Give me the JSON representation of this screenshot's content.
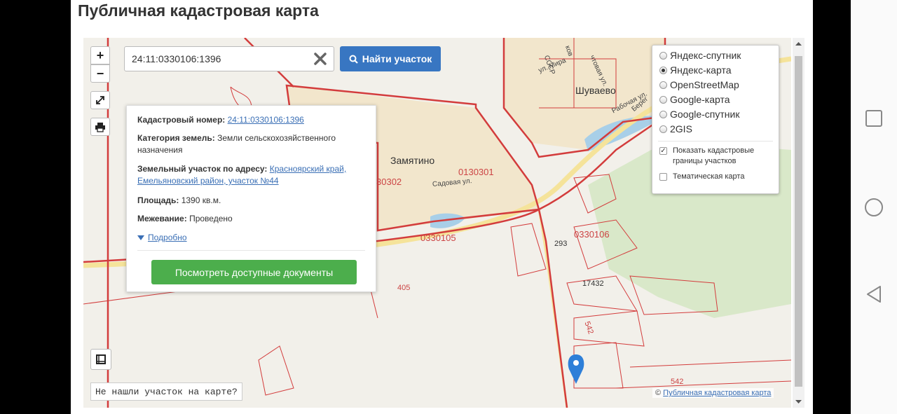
{
  "page": {
    "title": "Публичная кадастровая карта"
  },
  "search": {
    "value": "24:11:0330106:1396",
    "button_label": "Найти участок"
  },
  "map_controls": {
    "zoom_in": "+",
    "zoom_out": "−"
  },
  "layers": {
    "options": [
      {
        "label": "Яндекс-спутник",
        "selected": false
      },
      {
        "label": "Яндекс-карта",
        "selected": true
      },
      {
        "label": "OpenStreetMap",
        "selected": false
      },
      {
        "label": "Google-карта",
        "selected": false
      },
      {
        "label": "Google-спутник",
        "selected": false
      },
      {
        "label": "2GIS",
        "selected": false
      }
    ],
    "show_boundaries": {
      "label": "Показать кадастровые границы участков",
      "checked": true
    },
    "thematic": {
      "label": "Тематическая карта",
      "checked": false
    }
  },
  "info": {
    "cadastral_label": "Кадастровый номер:",
    "cadastral_value": "24:11:0330106:1396",
    "category_label": "Категория земель:",
    "category_value": "Земли сельскохозяйственного назначения",
    "address_label": "Земельный участок по адресу:",
    "address_value": "Красноярский край, Емельяновский район, участок №44",
    "area_label": "Площадь:",
    "area_value": "1390 кв.м.",
    "survey_label": "Межевание:",
    "survey_value": "Проведено",
    "more_link": "Подробно",
    "docs_button": "Посмотреть доступные документы"
  },
  "map_labels": {
    "shuvaevo": "Шуваево",
    "zamyatino": "Замятино",
    "q0130301": "0130301",
    "q30302": "30302",
    "q0330105": "0330105",
    "q0330106": "0330106",
    "n293": "293",
    "n17432": "17432",
    "n405": "405",
    "n542": "542",
    "n542b": "542",
    "sadovaya": "Садовая ул.",
    "mira": "ул. Мира",
    "rabochaya": "Рабочая ул.",
    "bereg": "Берег",
    "sssr": "СССР",
    "chkova": "ков",
    "chtovaya": "чтовая ул."
  },
  "notfound": "Не нашли участок на карте?",
  "attribution": {
    "prefix": "©",
    "link": "Публичная кадастровая карта"
  },
  "colors": {
    "boundary": "#d33c3c",
    "road": "#f5e39a",
    "water": "#a8cfe8",
    "settlement": "#f2e6cc",
    "forest": "#d9e8c9",
    "button_blue": "#3876c2",
    "button_green": "#4cae4c",
    "marker": "#2e7fd8"
  }
}
